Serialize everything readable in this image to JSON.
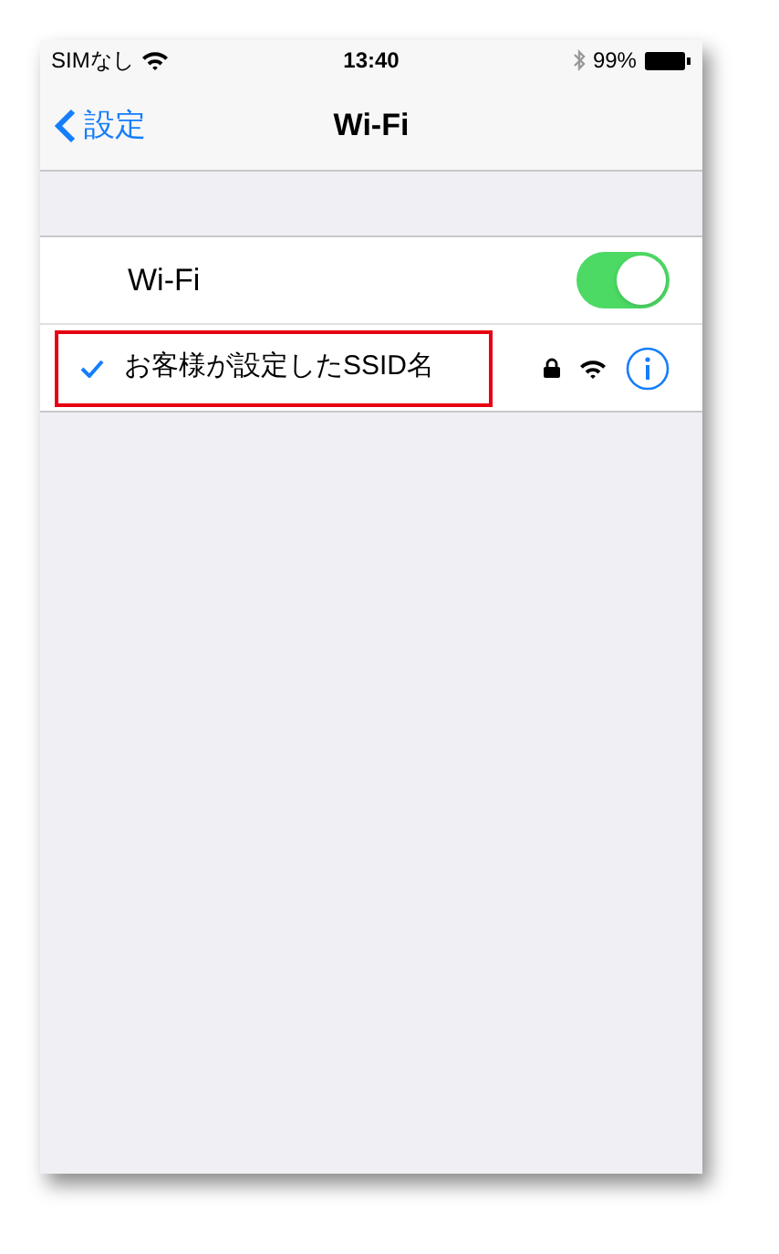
{
  "status_bar": {
    "carrier": "SIMなし",
    "time": "13:40",
    "battery": "99%"
  },
  "nav": {
    "back": "設定",
    "title": "Wi-Fi"
  },
  "wifi": {
    "label": "Wi-Fi",
    "on": true
  },
  "networks": [
    {
      "name": "お客様が設定したSSID名",
      "selected": true,
      "highlighted": true,
      "locked": true
    }
  ]
}
